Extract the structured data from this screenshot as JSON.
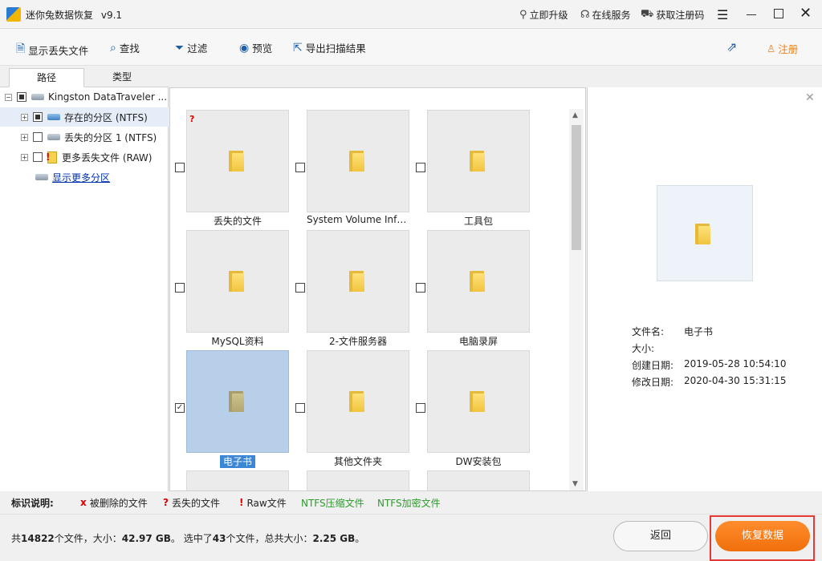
{
  "window": {
    "title": "迷你兔数据恢复",
    "version": "v9.1",
    "upgrade": "立即升级",
    "online_service": "在线服务",
    "get_code": "获取注册码"
  },
  "toolbar": {
    "show_lost": "显示丢失文件",
    "find": "查找",
    "filter": "过滤",
    "preview": "预览",
    "export": "导出扫描结果",
    "register": "注册"
  },
  "tabs": [
    {
      "label": "路径"
    },
    {
      "label": "类型"
    }
  ],
  "tree": {
    "root": "Kingston DataTraveler ...",
    "items": [
      {
        "label": "存在的分区 (NTFS)"
      },
      {
        "label": "丢失的分区 1 (NTFS)"
      },
      {
        "label": "更多丢失文件 (RAW)"
      }
    ],
    "show_more": "显示更多分区"
  },
  "files": [
    {
      "name": "丢失的文件",
      "lost": "?",
      "checked": false
    },
    {
      "name": "System Volume Infor...",
      "checked": false
    },
    {
      "name": "工具包",
      "checked": false
    },
    {
      "name": "MySQL资料",
      "checked": false
    },
    {
      "name": "2-文件服务器",
      "checked": false
    },
    {
      "name": "电脑录屏",
      "checked": false
    },
    {
      "name": "电子书",
      "checked": true,
      "selected": true
    },
    {
      "name": "其他文件夹",
      "checked": false
    },
    {
      "name": "DW安装包",
      "checked": false
    }
  ],
  "preview": {
    "name_label": "文件名:",
    "name": "电子书",
    "size_label": "大小:",
    "size": "",
    "created_label": "创建日期:",
    "created": "2019-05-28 10:54:10",
    "modified_label": "修改日期:",
    "modified": "2020-04-30 15:31:15"
  },
  "legend": {
    "title": "标识说明:",
    "deleted_mark": "x",
    "deleted": "被删除的文件",
    "lost_mark": "?",
    "lost": "丢失的文件",
    "raw_mark": "!",
    "raw": "Raw文件",
    "ntfs_compressed": "NTFS压缩文件",
    "ntfs_encrypted": "NTFS加密文件"
  },
  "status": {
    "p1": "共",
    "total_files": "14822",
    "p2": "个文件，大小：",
    "total_size": "42.97 GB",
    "p3": "。 选中了",
    "selected_files": "43",
    "p4": "个文件，总共大小：",
    "selected_size": "2.25 GB",
    "p5": "。"
  },
  "buttons": {
    "back": "返回",
    "restore": "恢复数据"
  },
  "colors": {
    "accent": "#f07f13",
    "selected": "#b8cfe9",
    "highlight": "#e53935"
  }
}
